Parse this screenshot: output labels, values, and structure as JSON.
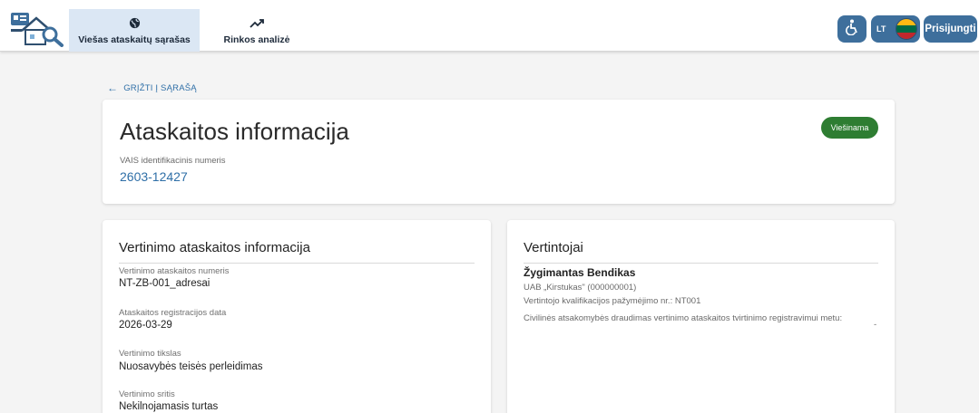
{
  "header": {
    "logo_icon": "house-search-logo-icon",
    "nav": [
      {
        "label": "Viešas ataskaitų sąrašas",
        "icon": "globe-icon",
        "active": true
      },
      {
        "label": "Rinkos analizė",
        "icon": "trending-up-icon",
        "active": false
      }
    ],
    "accessibility_icon": "accessibility-icon",
    "lang_label": "LT",
    "login_label": "Prisijungti",
    "colors": {
      "accent": "#3e6f9c",
      "active_tab": "#dbe7f4"
    }
  },
  "back_link": {
    "label": "GRĮŽTI Į SĄRAŠĄ",
    "icon": "arrow-left-icon"
  },
  "report": {
    "title": "Ataskaitos informacija",
    "status_badge": "Viešinama",
    "status_color": "#2e7d32",
    "vais_label": "VAIS identifikacinis numeris",
    "vais_value": "2603-12427"
  },
  "valuation": {
    "title": "Vertinimo ataskaitos informacija",
    "fields": [
      {
        "label": "Vertinimo ataskaitos numeris",
        "value": "NT-ZB-001_adresai"
      },
      {
        "label": "Ataskaitos registracijos data",
        "value": "2026-03-29"
      },
      {
        "label": "Vertinimo tikslas",
        "value": "Nuosavybės teisės perleidimas"
      },
      {
        "label": "Vertinimo sritis",
        "value": "Nekilnojamasis turtas"
      }
    ]
  },
  "appraisers": {
    "title": "Vertintojai",
    "name": "Žygimantas Bendikas",
    "company": "UAB „Kirstukas\" (000000001)",
    "qualification": "Vertintojo kvalifikacijos pažymėjimo nr.: NT001",
    "civil_label": "Civilinės atsakomybės draudimas vertinimo ataskaitos tvirtinimo registravimui metu:",
    "civil_value": "-"
  }
}
